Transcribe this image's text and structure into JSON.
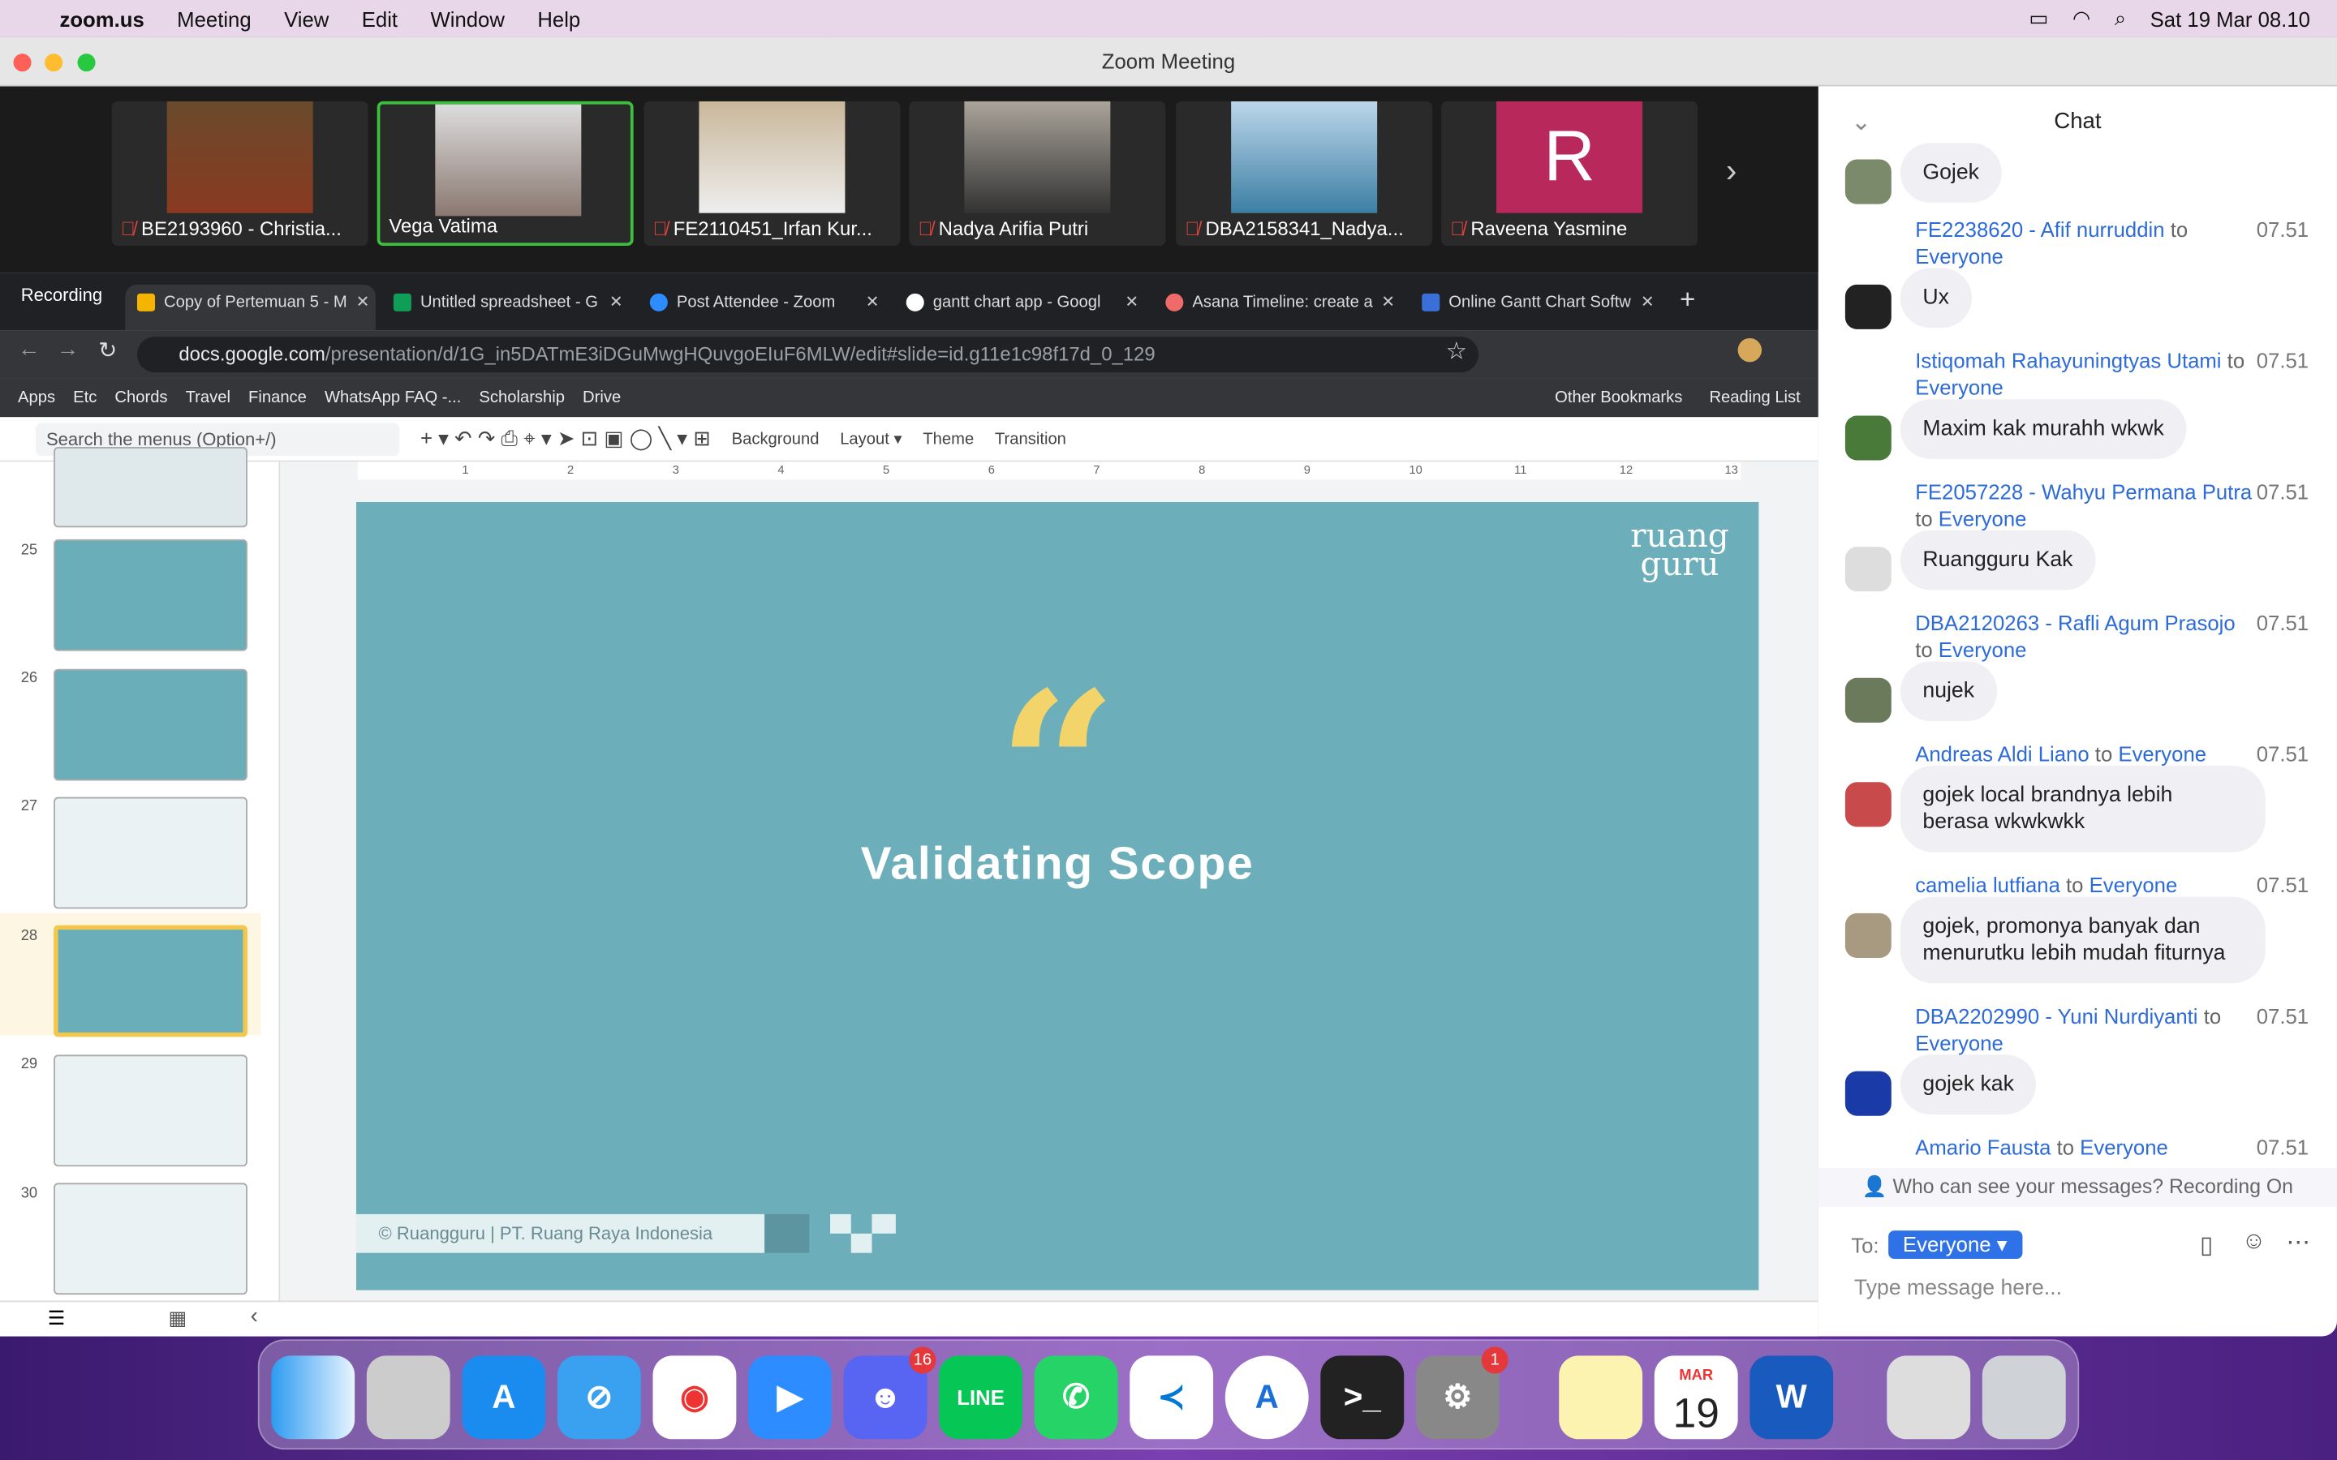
{
  "menubar": {
    "app": "zoom.us",
    "items": [
      "Meeting",
      "View",
      "Edit",
      "Window",
      "Help"
    ],
    "datetime": "Sat 19 Mar  08.10"
  },
  "window": {
    "title": "Zoom Meeting"
  },
  "participants": [
    {
      "name": "BE2193960 - Christia...",
      "muted": true
    },
    {
      "name": "Vega Vatima",
      "muted": false,
      "speaking": true
    },
    {
      "name": "FE2110451_Irfan Kur...",
      "muted": true
    },
    {
      "name": "Nadya Arifia Putri",
      "muted": true
    },
    {
      "name": "DBA2158341_Nadya...",
      "muted": true
    },
    {
      "name": "Raveena Yasmine",
      "muted": true,
      "initial": "R"
    }
  ],
  "browser": {
    "recording_label": "Recording",
    "tabs": [
      "Copy of Pertemuan 5 - M",
      "Untitled spreadsheet - G",
      "Post Attendee - Zoom",
      "gantt chart app - Googl",
      "Asana Timeline: create a",
      "Online Gantt Chart Softw"
    ],
    "url_host": "docs.google.com",
    "url_path": "/presentation/d/1G_in5DATmE3iDGuMwgHQuvgoEIuF6MLW/edit#slide=id.g11e1c98f17d_0_129",
    "bookmarks": [
      "Apps",
      "Etc",
      "Chords",
      "Travel",
      "Finance",
      "WhatsApp FAQ -...",
      "Scholarship",
      "Drive"
    ],
    "bookmarks_right": [
      "Other Bookmarks",
      "Reading List"
    ]
  },
  "slides": {
    "search_placeholder": "Search the menus (Option+/)",
    "toolbar": [
      "Background",
      "Layout ▾",
      "Theme",
      "Transition"
    ],
    "thumb_numbers": [
      "25",
      "26",
      "27",
      "28",
      "29",
      "30"
    ],
    "selected": "28",
    "ruler": [
      "1",
      "2",
      "3",
      "4",
      "5",
      "6",
      "7",
      "8",
      "9",
      "10",
      "11",
      "12",
      "13"
    ],
    "slide": {
      "quote": "“",
      "title": "Validating Scope",
      "logo": "ruang guru",
      "footer": "© Ruangguru | PT. Ruang Raya Indonesia",
      "bg": "#6caeb9",
      "accent": "#f3d46b"
    }
  },
  "chat": {
    "title": "Chat",
    "messages": [
      {
        "sender": "",
        "to": "",
        "time": "",
        "text": "Gojek"
      },
      {
        "sender": "FE2238620 - Afif nurruddin",
        "to": "Everyone",
        "time": "07.51",
        "text": "Ux"
      },
      {
        "sender": "Istiqomah Rahayuningtyas Utami",
        "to": "Everyone",
        "time": "07.51",
        "text": "Maxim kak murahh wkwk"
      },
      {
        "sender": "FE2057228 - Wahyu Permana Putra",
        "to": "Everyone",
        "time": "07.51",
        "text": "Ruangguru Kak"
      },
      {
        "sender": "DBA2120263 - Rafli Agum Prasojo",
        "to": "Everyone",
        "time": "07.51",
        "text": "nujek"
      },
      {
        "sender": "Andreas Aldi Liano",
        "to": "Everyone",
        "time": "07.51",
        "text": "gojek local brandnya lebih berasa wkwkwkk"
      },
      {
        "sender": "camelia lutfiana",
        "to": "Everyone",
        "time": "07.51",
        "text": "gojek, promonya banyak dan menurutku lebih mudah fiturnya"
      },
      {
        "sender": "DBA2202990 - Yuni Nurdiyanti",
        "to": "Everyone",
        "time": "07.51",
        "text": "gojek kak"
      },
      {
        "sender": "Amario Fausta",
        "to": "Everyone",
        "time": "07.51",
        "text": ""
      }
    ],
    "to_word": "to",
    "privacy": "Who can see your messages? Recording On",
    "to_label": "To:",
    "recipient": "Everyone ▾",
    "input_placeholder": "Type message here..."
  },
  "dock": {
    "calendar_month": "MAR",
    "calendar_day": "19",
    "discord_badge": "16",
    "settings_badge": "1"
  }
}
